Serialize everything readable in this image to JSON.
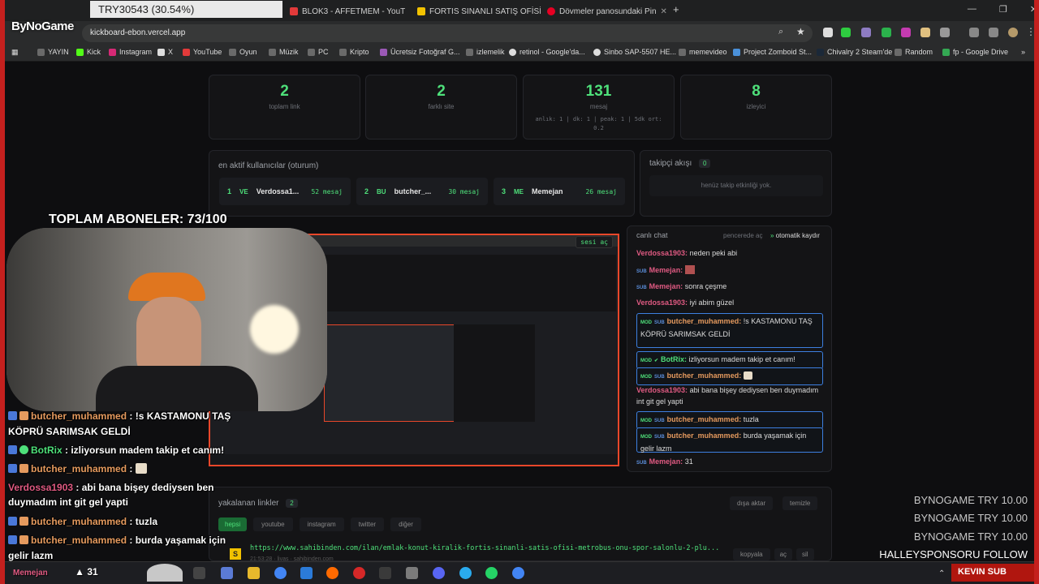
{
  "stream_overlay": {
    "price_tag": "TRY30543 (30.54%)",
    "channel_logo": "ByNoGame",
    "subs_goal": "TOPLAM ABONELER: 73/100",
    "viewer_count": "31",
    "viewer_name": "Memejan",
    "ticker_right": "KEVIN   SUB",
    "sponsor_lines": [
      "BYNOGAME   TRY 10.00",
      "BYNOGAME   TRY 10.00",
      "BYNOGAME   TRY 10.00",
      "HALLEYSPONSORU   FOLLOW"
    ],
    "chat": [
      {
        "user": "butcher_muhammed",
        "text": ": !s KASTAMONU TAŞ",
        "cont": "KÖPRÜ SARIMSAK GELDİ",
        "color": "u1"
      },
      {
        "user": "BotRix",
        "text": ": izliyorsun madem takip et canım!",
        "color": "u2"
      },
      {
        "user": "butcher_muhammed",
        "text": ":",
        "color": "u1"
      },
      {
        "user": "Verdossa1903",
        "text": ": abi bana bişey dediysen ben",
        "cont": "duymadım int git gel yapti",
        "color": "u3"
      },
      {
        "user": "butcher_muhammed",
        "text": ": tuzla",
        "color": "u1"
      },
      {
        "user": "butcher_muhammed",
        "text": ": burda yaşamak için",
        "cont": "gelir lazm",
        "color": "u1"
      }
    ]
  },
  "browser": {
    "tabs": [
      {
        "title": "BLOK3 - AFFETMEM - YouT",
        "color": "#e23a3a"
      },
      {
        "title": "FORTIS SINANLI SATIŞ OFİSİ M",
        "color": "#f2c200"
      },
      {
        "title": "Dövmeler panosundaki Pin",
        "color": "#e60023"
      }
    ],
    "url": "kickboard-ebon.vercel.app",
    "bookmarks": [
      "YAYIN",
      "Kick",
      "Instagram",
      "X",
      "YouTube",
      "Oyun",
      "Müzik",
      "PC",
      "Kripto",
      "Ücretsiz Fotoğraf G...",
      "izlemelik",
      "retinol - Google'da...",
      "Sinbo SAP-5507 HE...",
      "memevideo",
      "Project Zomboid St...",
      "Chivalry 2 Steam'de",
      "Random",
      "fp - Google Drive"
    ]
  },
  "stats": [
    {
      "value": "2",
      "label": "toplam link"
    },
    {
      "value": "2",
      "label": "farklı site"
    },
    {
      "value": "131",
      "label": "mesaj",
      "sub": "anlık: 1 | dk: 1 | peak: 1 | 5dk ort: 0.2"
    },
    {
      "value": "8",
      "label": "izleyici"
    }
  ],
  "active_users": {
    "title": "en aktif kullanıcılar (oturum)",
    "list": [
      {
        "rank": "1",
        "abbr": "VE",
        "name": "Verdossa1...",
        "count": "52 mesaj"
      },
      {
        "rank": "2",
        "abbr": "BU",
        "name": "butcher_...",
        "count": "30 mesaj"
      },
      {
        "rank": "3",
        "abbr": "ME",
        "name": "Memejan",
        "count": "26 mesaj"
      }
    ]
  },
  "followers": {
    "title": "takipçi akışı",
    "count": "0",
    "empty": "henüz takip etkinliği yok."
  },
  "live_chat": {
    "title": "canlı chat",
    "popout": "pencerede aç",
    "autoscroll": "otomatik kaydır",
    "messages": [
      {
        "user": "Verdossa1903:",
        "text": "neden peki abi",
        "kind": "plain",
        "ucolor": "#e05a82"
      },
      {
        "user": "Memejan:",
        "text": "",
        "kind": "sub",
        "ucolor": "#e05a82"
      },
      {
        "user": "Memejan:",
        "text": "sonra çeşme",
        "kind": "sub",
        "ucolor": "#e05a82"
      },
      {
        "user": "Verdossa1903:",
        "text": "iyi abim güzel",
        "kind": "plain",
        "ucolor": "#e05a82"
      },
      {
        "user": "butcher_muhammed:",
        "text": "!s KASTAMONU TAŞ KÖPRÜ SARIMSAK GELDİ",
        "kind": "modsub",
        "ucolor": "#e59a5e"
      },
      {
        "user": "BotRix:",
        "text": "izliyorsun madem takip et canım!",
        "kind": "mod",
        "ucolor": "#4ee07a"
      },
      {
        "user": "butcher_muhammed:",
        "text": "",
        "kind": "modsub",
        "ucolor": "#e59a5e"
      },
      {
        "user": "Verdossa1903:",
        "text": "abi bana bişey dediysen ben duymadım int git gel yapti",
        "kind": "plain",
        "ucolor": "#e05a82"
      },
      {
        "user": "butcher_muhammed:",
        "text": "tuzla",
        "kind": "modsub",
        "ucolor": "#e59a5e"
      },
      {
        "user": "butcher_muhammed:",
        "text": "burda yaşamak için gelir lazm",
        "kind": "modsub",
        "ucolor": "#e59a5e"
      },
      {
        "user": "Memejan:",
        "text": "31",
        "kind": "sub",
        "ucolor": "#e05a82"
      }
    ]
  },
  "links": {
    "title": "yakalanan linkler",
    "count": "2",
    "export": "dışa aktar",
    "clear": "temizle",
    "filters": [
      "hepsi",
      "youtube",
      "instagram",
      "twitter",
      "diğer"
    ],
    "item_url": "https://www.sahibinden.com/ilan/emlak-konut-kiralik-fortis-sinanli-satis-ofisi-metrobus-onu-spor-salonlu-2-plu...",
    "item_meta": "21:53:28 · livas · sahibinden.com",
    "item_letter": "S",
    "actions": [
      "kopyala",
      "aç",
      "sil"
    ]
  },
  "preview_label": "sesi aç"
}
